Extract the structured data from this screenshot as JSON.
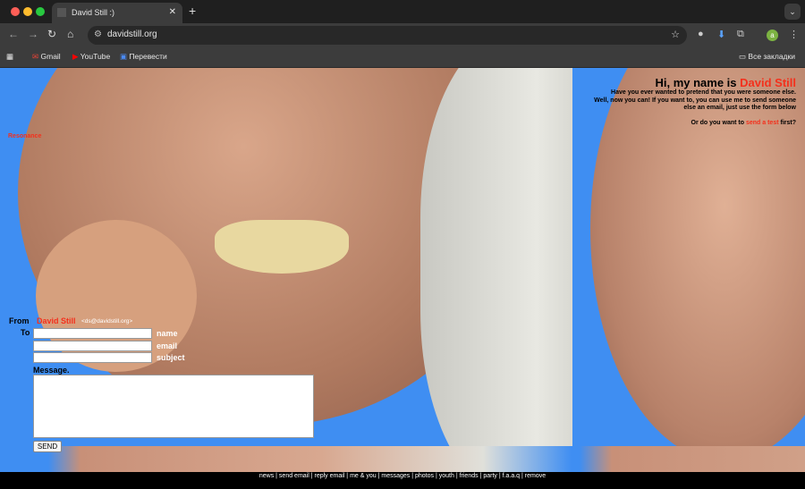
{
  "browser": {
    "tab_title": "David Still :)",
    "url": "davidstill.org",
    "bookmarks": [
      "Gmail",
      "YouTube",
      "Перевести"
    ],
    "all_bookmarks": "Все закладки",
    "profile_initial": "a"
  },
  "page": {
    "greeting_prefix": "Hi, my name is ",
    "greeting_name": "David Still",
    "intro_lines": [
      "Have you ever wanted to pretend that you were someone else.",
      "Well, now you can! If you want to, you can use me to send someone",
      "else an email, just use the form below"
    ],
    "test_prefix": "Or do you want to ",
    "test_link": "send a test",
    "test_suffix": " first?",
    "resonance": "Resonance",
    "form": {
      "from_label": "From",
      "from_name": "David Still",
      "from_email": "<ds@davidstill.org>",
      "to_label": "To",
      "name_label": "name",
      "email_label": "email",
      "subject_label": "subject",
      "message_label": "Message.",
      "send": "SEND"
    },
    "footer_links": [
      "news",
      "send email",
      "reply email",
      "me & you",
      "messages",
      "photos",
      "youth",
      "friends",
      "party",
      "f.a.a.q",
      "remove"
    ]
  }
}
